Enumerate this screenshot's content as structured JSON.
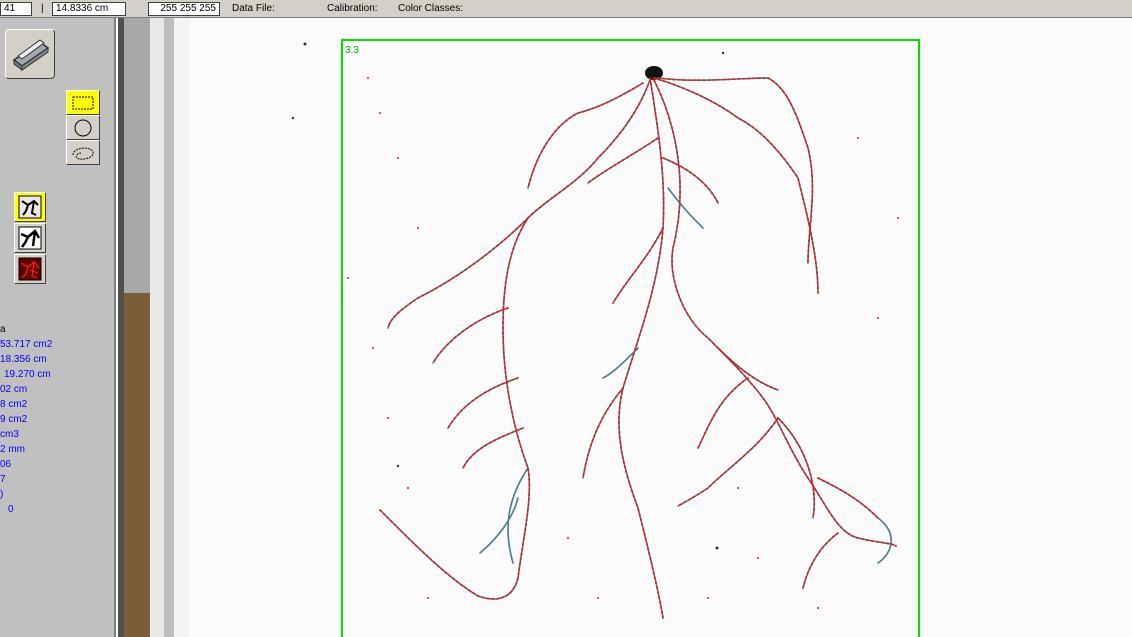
{
  "statusbar": {
    "field1": "41",
    "separator": "|",
    "field2": "14.8336 cm",
    "field3": "255 255 255",
    "data_file_label": "Data File:",
    "calibration_label": "Calibration:",
    "color_classes_label": "Color Classes:"
  },
  "tools": {
    "scanner": "scanner-icon",
    "rect": "rectangle-select-icon",
    "ellipse": "ellipse-select-icon",
    "lasso": "lasso-select-icon",
    "analysis1": "root-skeleton-icon",
    "analysis2": "root-binary-icon",
    "analysis3": "root-overlay-icon"
  },
  "stats": [
    {
      "text": "a",
      "color": "#000000"
    },
    {
      "text": "53.717 cm2"
    },
    {
      "text": "18.356 cm"
    },
    {
      "text": "19.270 cm"
    },
    {
      "text": "02 cm"
    },
    {
      "text": "8 cm2"
    },
    {
      "text": "9 cm2"
    },
    {
      "text": "cm3"
    },
    {
      "text": "2 mm"
    },
    {
      "text": "06"
    },
    {
      "text": "7"
    },
    {
      "text": ")"
    },
    {
      "text": "0"
    }
  ],
  "region": {
    "label": "3.3",
    "border_color": "#00e000"
  }
}
